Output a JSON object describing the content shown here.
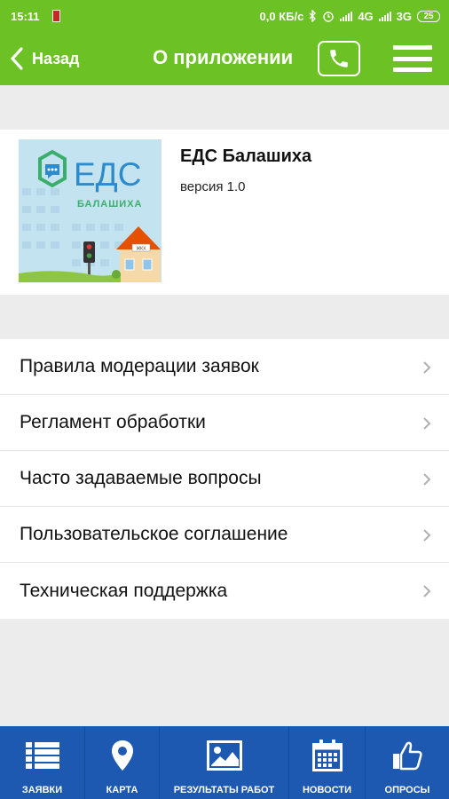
{
  "status_bar": {
    "time": "15:11",
    "network_speed": "0,0 КБ/с",
    "network_4g": "4G",
    "network_3g": "3G",
    "battery": "25"
  },
  "header": {
    "back_label": "Назад",
    "title": "О приложении",
    "background_color": "#6cc124"
  },
  "about": {
    "app_name": "ЕДС Балашиха",
    "version": "версия 1.0",
    "logo_text": "ЕДС",
    "logo_subtext": "БАЛАШИХА",
    "logo_sign": "ЖКХ"
  },
  "menu": {
    "items": [
      {
        "label": "Правила модерации заявок"
      },
      {
        "label": "Регламент обработки"
      },
      {
        "label": "Часто задаваемые вопросы"
      },
      {
        "label": "Пользовательское соглашение"
      },
      {
        "label": "Техническая поддержка"
      }
    ]
  },
  "tabbar": {
    "background_color": "#1d59b0",
    "tabs": [
      {
        "label": "ЗАЯВКИ",
        "icon": "list-icon"
      },
      {
        "label": "КАРТА",
        "icon": "map-pin-icon"
      },
      {
        "label": "РЕЗУЛЬТАТЫ РАБОТ",
        "icon": "image-icon"
      },
      {
        "label": "НОВОСТИ",
        "icon": "calendar-icon"
      },
      {
        "label": "ОПРОСЫ",
        "icon": "thumbs-up-icon"
      }
    ]
  }
}
